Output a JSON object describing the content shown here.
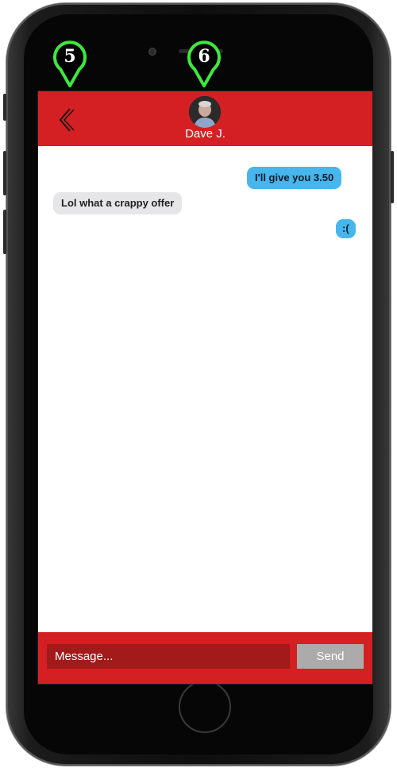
{
  "header": {
    "contact_name": "Dave J."
  },
  "messages": [
    {
      "direction": "outgoing",
      "text": "I'll give you 3.50"
    },
    {
      "direction": "incoming",
      "text": "Lol what a crappy offer"
    },
    {
      "direction": "outgoing",
      "text": ":("
    }
  ],
  "composer": {
    "placeholder": "Message...",
    "send_label": "Send"
  },
  "annotations": {
    "back_marker": "5",
    "contact_marker": "6"
  },
  "colors": {
    "header_red": "#d42022",
    "input_dark_red": "#a31a1b",
    "outgoing_bubble": "#46b6ec",
    "incoming_bubble": "#e6e6e9",
    "marker_green": "#3ee83e"
  },
  "icons": {
    "back": "chevron-left-icon",
    "avatar": "avatar",
    "marker": "location-pin-icon"
  }
}
